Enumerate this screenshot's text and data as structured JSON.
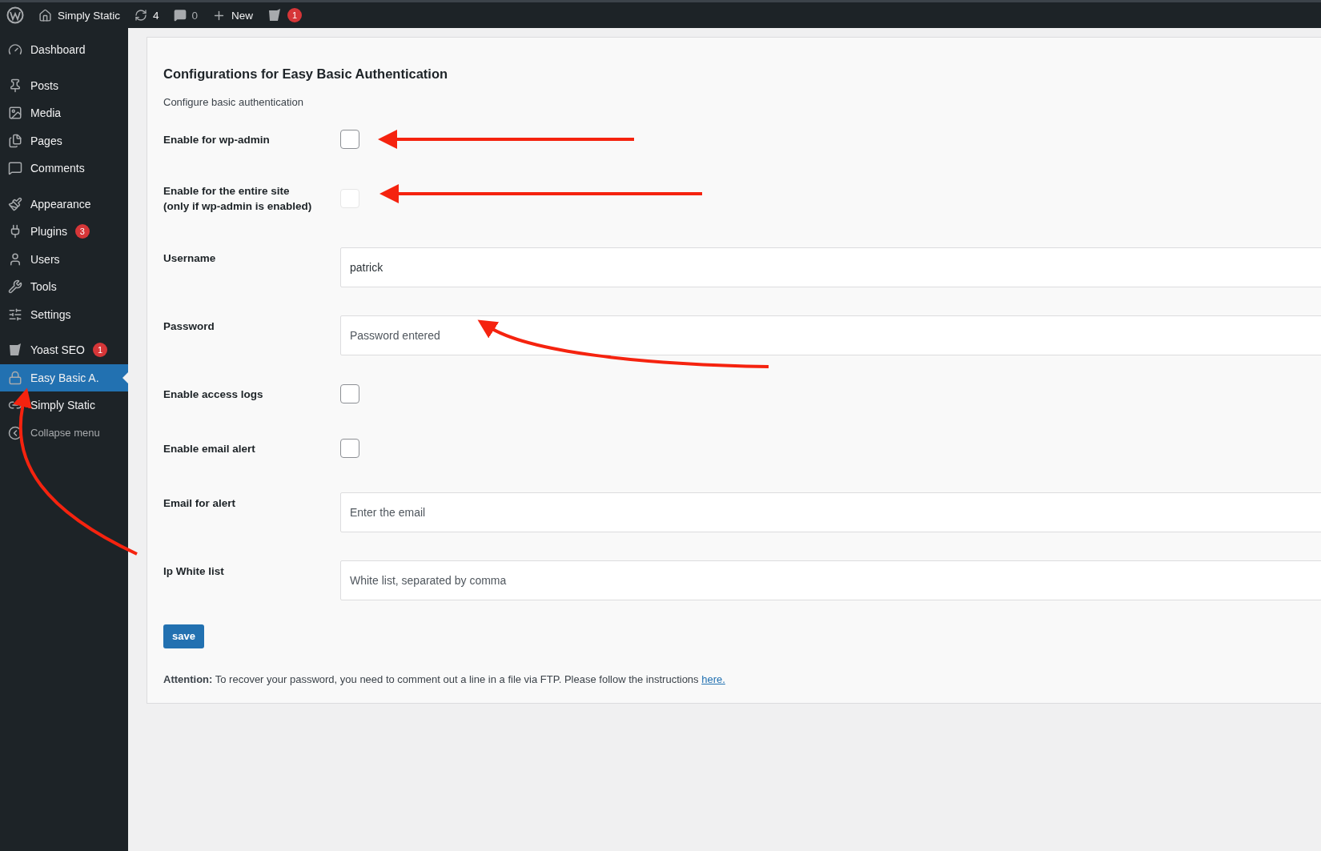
{
  "admin_bar": {
    "site": "Simply Static",
    "updates": "4",
    "comments": "0",
    "new": "New",
    "seo_badge": "1"
  },
  "sidebar": {
    "groups": [
      [
        {
          "label": "Dashboard",
          "selected": false
        }
      ],
      [
        {
          "label": "Posts",
          "selected": false
        },
        {
          "label": "Media",
          "selected": false
        },
        {
          "label": "Pages",
          "selected": false
        },
        {
          "label": "Comments",
          "selected": false
        }
      ],
      [
        {
          "label": "Appearance",
          "selected": false
        },
        {
          "label": "Plugins",
          "badge": "3",
          "selected": false
        },
        {
          "label": "Users",
          "selected": false
        },
        {
          "label": "Tools",
          "selected": false
        },
        {
          "label": "Settings",
          "selected": false
        }
      ],
      [
        {
          "label": "Yoast SEO",
          "badge": "1",
          "selected": false
        },
        {
          "label": "Easy Basic A.",
          "selected": true
        },
        {
          "label": "Simply Static",
          "selected": false
        },
        {
          "label": "Collapse menu",
          "selected": false
        }
      ]
    ]
  },
  "form": {
    "title": "Configurations for Easy Basic Authentication",
    "subtitle": "Configure basic authentication",
    "fields": [
      {
        "kind": "checkbox",
        "label": "Enable for wp-admin",
        "checked": false,
        "disabled": false
      },
      {
        "kind": "checkbox",
        "label": "Enable for the entire site\n(only if wp-admin is enabled)",
        "checked": false,
        "disabled": true
      },
      {
        "kind": "text",
        "label": "Username",
        "value": "patrick"
      },
      {
        "kind": "text",
        "label": "Password",
        "placeholder": "Password entered"
      },
      {
        "kind": "checkbox",
        "label": "Enable access logs",
        "checked": false,
        "disabled": false
      },
      {
        "kind": "checkbox",
        "label": "Enable email alert",
        "checked": false,
        "disabled": false
      },
      {
        "kind": "text",
        "label": "Email for alert",
        "placeholder": "Enter the email"
      },
      {
        "kind": "text",
        "label": "Ip White list",
        "placeholder": "White list, separated by comma"
      }
    ],
    "save": "save",
    "note": "**Attention:** To recover your password, you need to comment out a line in a file via FTP. Please follow the instructions",
    "note_link": "here."
  }
}
